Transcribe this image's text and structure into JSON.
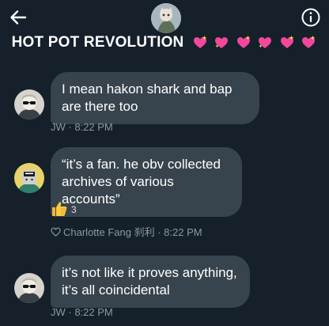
{
  "header": {
    "title": "HOT POT REVOLUTION",
    "hearts": [
      "sparkling-heart",
      "sparkling-heart",
      "sparkling-heart",
      "sparkling-heart",
      "sparkling-heart",
      "sparkling-heart"
    ]
  },
  "messages": [
    {
      "text": "I mean hakon shark and bap are there too",
      "sender": "JW",
      "time": "8:22 PM",
      "meta": "JW · 8:22 PM"
    },
    {
      "text": "“it’s a fan. he obv collected archives of various accounts”",
      "reaction_emoji": "thumbs-up",
      "reaction_count": "3",
      "liked_by": "Charlotte Fang 刹利",
      "time": "8:22 PM",
      "meta": "Charlotte Fang 刹利 · 8:22 PM"
    },
    {
      "text": "it’s not like it proves anything, it’s all coincidental",
      "sender": "JW",
      "time": "8:22 PM",
      "meta": "JW · 8:22 PM"
    }
  ],
  "colors": {
    "background": "#15202b",
    "bubble": "#38444d",
    "meta_text": "#8b98a5"
  }
}
